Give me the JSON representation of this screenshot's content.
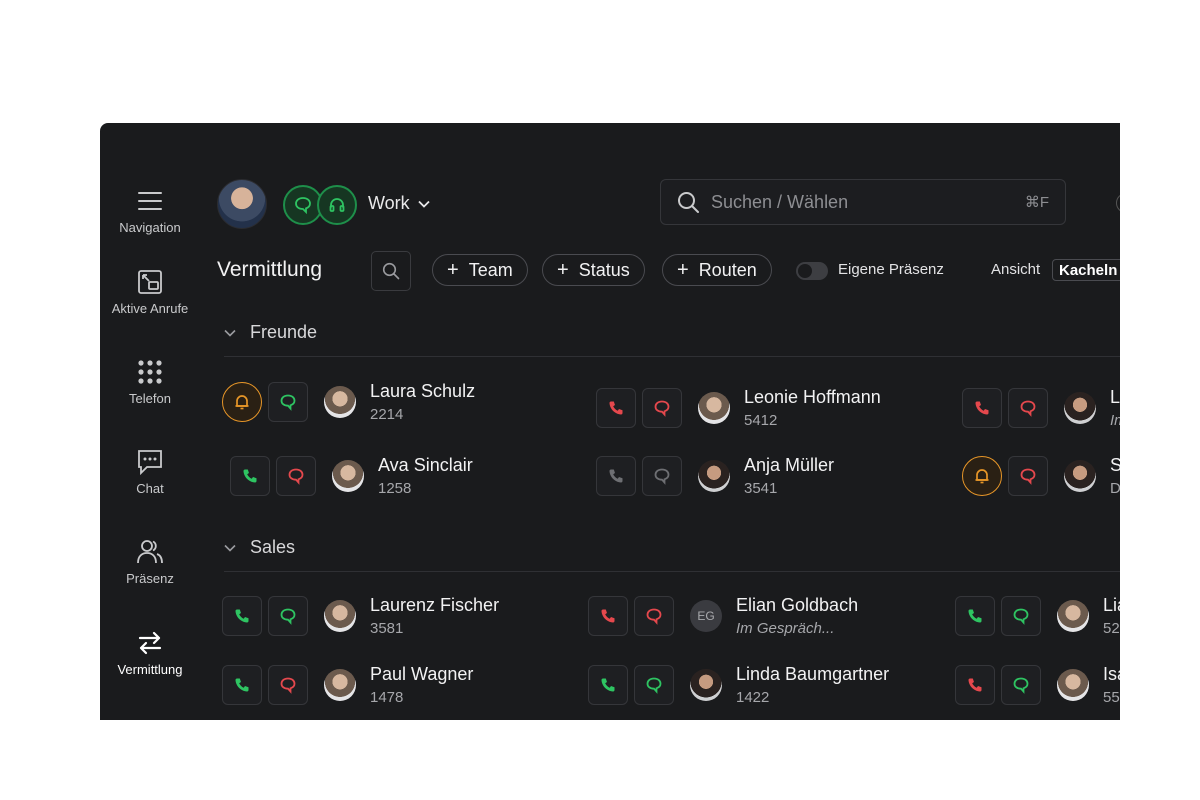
{
  "sidebar": {
    "items": [
      {
        "label": "Navigation",
        "icon": "menu-icon"
      },
      {
        "label": "Aktive Anrufe",
        "icon": "active-calls-icon"
      },
      {
        "label": "Telefon",
        "icon": "dialpad-icon"
      },
      {
        "label": "Chat",
        "icon": "chat-icon"
      },
      {
        "label": "Präsenz",
        "icon": "presence-icon"
      },
      {
        "label": "Vermittlung",
        "icon": "transfer-icon",
        "active": true
      }
    ]
  },
  "header": {
    "profile": "Work",
    "search_placeholder": "Suchen / Wählen",
    "search_shortcut": "⌘F"
  },
  "toolbar": {
    "title": "Vermittlung",
    "chips": [
      "Team",
      "Status",
      "Routen"
    ],
    "presence_toggle_label": "Eigene Präsenz",
    "view_label": "Ansicht",
    "view_value": "Kacheln"
  },
  "groups": [
    {
      "name": "Freunde",
      "contacts": [
        {
          "name": "Laura Schulz",
          "ext": "2214",
          "state": "ringing"
        },
        {
          "name": "Leonie Hoffmann",
          "ext": "5412",
          "state": "busy"
        },
        {
          "name": "Li",
          "ext": "Im",
          "state": "busy",
          "italic": true
        },
        {
          "name": "Ava Sinclair",
          "ext": "1258",
          "state": "available-busy-chat"
        },
        {
          "name": "Anja Müller",
          "ext": "3541",
          "state": "offline"
        },
        {
          "name": "So",
          "ext": "DN",
          "state": "ringing"
        }
      ]
    },
    {
      "name": "Sales",
      "contacts": [
        {
          "name": "Laurenz Fischer",
          "ext": "3581",
          "state": "available"
        },
        {
          "name": "Elian Goldbach",
          "ext": "Im Gespräch...",
          "state": "busy",
          "initials": "EG",
          "italic": true
        },
        {
          "name": "Lia",
          "ext": "52",
          "state": "available"
        },
        {
          "name": "Paul Wagner",
          "ext": "1478",
          "state": "available-busy-chat"
        },
        {
          "name": "Linda Baumgartner",
          "ext": "1422",
          "state": "available"
        },
        {
          "name": "Isa",
          "ext": "55",
          "state": "busy-phone-available-chat"
        }
      ]
    }
  ],
  "colors": {
    "background": "#1a1b1d",
    "green": "#2ec462",
    "red": "#e5484d",
    "orange": "#e79628",
    "gray": "#7b7c80"
  }
}
